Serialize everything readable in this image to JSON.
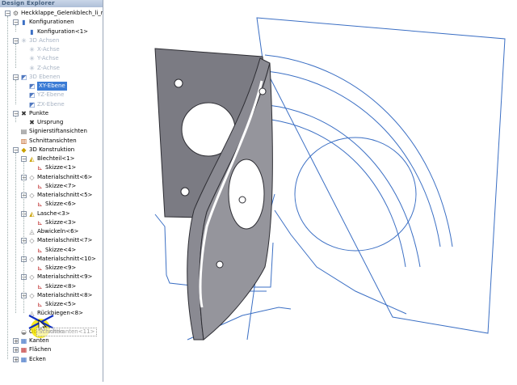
{
  "explorer": {
    "title": "Design Explorer",
    "tree": [
      {
        "label": "Heckklappe_Gelenkblech_li_r",
        "expander": "−",
        "icon": "part-icon"
      },
      {
        "label": "Konfigurationen",
        "expander": "−",
        "icon": "config-folder-icon"
      },
      {
        "label": "Konfiguration<1>",
        "icon": "config-icon"
      },
      {
        "label": "3D Achsen",
        "expander": "−",
        "icon": "axes-icon",
        "dim": true
      },
      {
        "label": "X-Achse",
        "icon": "axis-icon",
        "dim": true
      },
      {
        "label": "Y-Achse",
        "icon": "axis-icon",
        "dim": true
      },
      {
        "label": "Z-Achse",
        "icon": "axis-icon",
        "dim": true
      },
      {
        "label": "3D Ebenen",
        "expander": "−",
        "icon": "planes-icon",
        "dim": true
      },
      {
        "label": "XY-Ebene",
        "icon": "plane-icon",
        "selected": true
      },
      {
        "label": "YZ-Ebene",
        "icon": "plane-icon",
        "dim": true
      },
      {
        "label": "ZX-Ebene",
        "icon": "plane-icon",
        "dim": true
      },
      {
        "label": "Punkte",
        "expander": "−",
        "icon": "points-icon"
      },
      {
        "label": "Ursprung",
        "icon": "origin-icon"
      },
      {
        "label": "Signierstiftansichten",
        "icon": "signature-view-icon"
      },
      {
        "label": "Schnittansichten",
        "icon": "section-view-icon"
      },
      {
        "label": "3D Konstruktion",
        "expander": "−",
        "icon": "construction-icon"
      },
      {
        "label": "Blechteil<1>",
        "expander": "−",
        "icon": "sheetmetal-icon"
      },
      {
        "label": "Skizze<1>",
        "icon": "sketch-icon"
      },
      {
        "label": "Materialschnitt<6>",
        "expander": "−",
        "icon": "cut-icon"
      },
      {
        "label": "Skizze<7>",
        "icon": "sketch-icon"
      },
      {
        "label": "Materialschnitt<5>",
        "expander": "−",
        "icon": "cut-icon"
      },
      {
        "label": "Skizze<6>",
        "icon": "sketch-icon"
      },
      {
        "label": "Lasche<3>",
        "expander": "−",
        "icon": "tab-icon"
      },
      {
        "label": "Skizze<3>",
        "icon": "sketch-icon"
      },
      {
        "label": "Abwickeln<6>",
        "icon": "unfold-icon"
      },
      {
        "label": "Materialschnitt<7>",
        "expander": "−",
        "icon": "cut-icon"
      },
      {
        "label": "Skizze<4>",
        "icon": "sketch-icon"
      },
      {
        "label": "Materialschnitt<10>",
        "expander": "−",
        "icon": "cut-icon"
      },
      {
        "label": "Skizze<9>",
        "icon": "sketch-icon"
      },
      {
        "label": "Materialschnitt<9>",
        "expander": "−",
        "icon": "cut-icon"
      },
      {
        "label": "Skizze<8>",
        "icon": "sketch-icon"
      },
      {
        "label": "Materialschnitt<8>",
        "expander": "−",
        "icon": "cut-icon"
      },
      {
        "label": "Skizze<5>",
        "icon": "sketch-icon"
      },
      {
        "label": "Rückbiegen<8>",
        "icon": "rebend-icon"
      },
      {
        "label": "",
        "icon": "blank"
      },
      {
        "label": "Oberflächen",
        "icon": "surfaces-icon"
      },
      {
        "label": "Kanten",
        "expander": "+",
        "icon": "edges-icon"
      },
      {
        "label": "Flächen",
        "expander": "+",
        "icon": "faces-icon"
      },
      {
        "label": "Ecken",
        "expander": "+",
        "icon": "corners-icon"
      }
    ],
    "drag_label": "Schnittkanten<11>"
  },
  "colors": {
    "sketch_blue": "#3b6fc4",
    "highlight_yellow": "#f4e400",
    "selection_blue": "#3a7bd5"
  }
}
